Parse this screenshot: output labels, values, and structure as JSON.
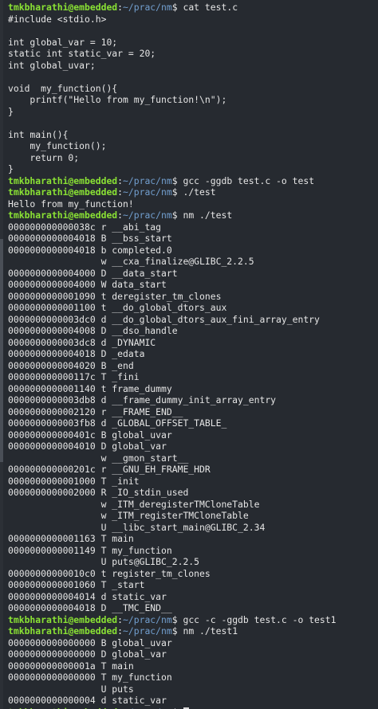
{
  "prompt": {
    "user_host": "tmkbharathi@embedded",
    "path": "~/prac/nm"
  },
  "lines": [
    {
      "type": "prompt",
      "cmd": "cat test.c"
    },
    {
      "type": "out",
      "text": "#include <stdio.h>"
    },
    {
      "type": "out",
      "text": ""
    },
    {
      "type": "out",
      "text": "int global_var = 10;"
    },
    {
      "type": "out",
      "text": "static int static_var = 20;"
    },
    {
      "type": "out",
      "text": "int global_uvar;"
    },
    {
      "type": "out",
      "text": ""
    },
    {
      "type": "out",
      "text": "void  my_function(){"
    },
    {
      "type": "out",
      "text": "    printf(\"Hello from my_function!\\n\");"
    },
    {
      "type": "out",
      "text": "}"
    },
    {
      "type": "out",
      "text": ""
    },
    {
      "type": "out",
      "text": "int main(){"
    },
    {
      "type": "out",
      "text": "    my_function();"
    },
    {
      "type": "out",
      "text": "    return 0;"
    },
    {
      "type": "out",
      "text": "}"
    },
    {
      "type": "prompt",
      "cmd": "gcc -ggdb test.c -o test"
    },
    {
      "type": "prompt",
      "cmd": "./test"
    },
    {
      "type": "out",
      "text": "Hello from my_function!"
    },
    {
      "type": "prompt",
      "cmd": "nm ./test"
    },
    {
      "type": "out",
      "text": "000000000000038c r __abi_tag"
    },
    {
      "type": "out",
      "text": "0000000000004018 B __bss_start"
    },
    {
      "type": "out",
      "text": "0000000000004018 b completed.0"
    },
    {
      "type": "out",
      "text": "                 w __cxa_finalize@GLIBC_2.2.5"
    },
    {
      "type": "out",
      "text": "0000000000004000 D __data_start"
    },
    {
      "type": "out",
      "text": "0000000000004000 W data_start"
    },
    {
      "type": "out",
      "text": "0000000000001090 t deregister_tm_clones"
    },
    {
      "type": "out",
      "text": "0000000000001100 t __do_global_dtors_aux"
    },
    {
      "type": "out",
      "text": "0000000000003dc0 d __do_global_dtors_aux_fini_array_entry"
    },
    {
      "type": "out",
      "text": "0000000000004008 D __dso_handle"
    },
    {
      "type": "out",
      "text": "0000000000003dc8 d _DYNAMIC"
    },
    {
      "type": "out",
      "text": "0000000000004018 D _edata"
    },
    {
      "type": "out",
      "text": "0000000000004020 B _end"
    },
    {
      "type": "out",
      "text": "000000000000117c T _fini"
    },
    {
      "type": "out",
      "text": "0000000000001140 t frame_dummy"
    },
    {
      "type": "out",
      "text": "0000000000003db8 d __frame_dummy_init_array_entry"
    },
    {
      "type": "out",
      "text": "0000000000002120 r __FRAME_END__"
    },
    {
      "type": "out",
      "text": "0000000000003fb8 d _GLOBAL_OFFSET_TABLE_"
    },
    {
      "type": "out",
      "text": "000000000000401c B global_uvar"
    },
    {
      "type": "out",
      "text": "0000000000004010 D global_var"
    },
    {
      "type": "out",
      "text": "                 w __gmon_start__"
    },
    {
      "type": "out",
      "text": "000000000000201c r __GNU_EH_FRAME_HDR"
    },
    {
      "type": "out",
      "text": "0000000000001000 T _init"
    },
    {
      "type": "out",
      "text": "0000000000002000 R _IO_stdin_used"
    },
    {
      "type": "out",
      "text": "                 w _ITM_deregisterTMCloneTable"
    },
    {
      "type": "out",
      "text": "                 w _ITM_registerTMCloneTable"
    },
    {
      "type": "out",
      "text": "                 U __libc_start_main@GLIBC_2.34"
    },
    {
      "type": "out",
      "text": "0000000000001163 T main"
    },
    {
      "type": "out",
      "text": "0000000000001149 T my_function"
    },
    {
      "type": "out",
      "text": "                 U puts@GLIBC_2.2.5"
    },
    {
      "type": "out",
      "text": "00000000000010c0 t register_tm_clones"
    },
    {
      "type": "out",
      "text": "0000000000001060 T _start"
    },
    {
      "type": "out",
      "text": "0000000000004014 d static_var"
    },
    {
      "type": "out",
      "text": "0000000000004018 D __TMC_END__"
    },
    {
      "type": "prompt",
      "cmd": "gcc -c -ggdb test.c -o test1"
    },
    {
      "type": "prompt",
      "cmd": "nm ./test1"
    },
    {
      "type": "out",
      "text": "0000000000000000 B global_uvar"
    },
    {
      "type": "out",
      "text": "0000000000000000 D global_var"
    },
    {
      "type": "out",
      "text": "000000000000001a T main"
    },
    {
      "type": "out",
      "text": "0000000000000000 T my_function"
    },
    {
      "type": "out",
      "text": "                 U puts"
    },
    {
      "type": "out",
      "text": "0000000000000004 d static_var"
    },
    {
      "type": "prompt",
      "cmd": "",
      "cursor": true
    }
  ],
  "colors": {
    "background": "#262a30",
    "text": "#e6e6e6",
    "user_host": "#8ae234",
    "path": "#729fcf"
  }
}
